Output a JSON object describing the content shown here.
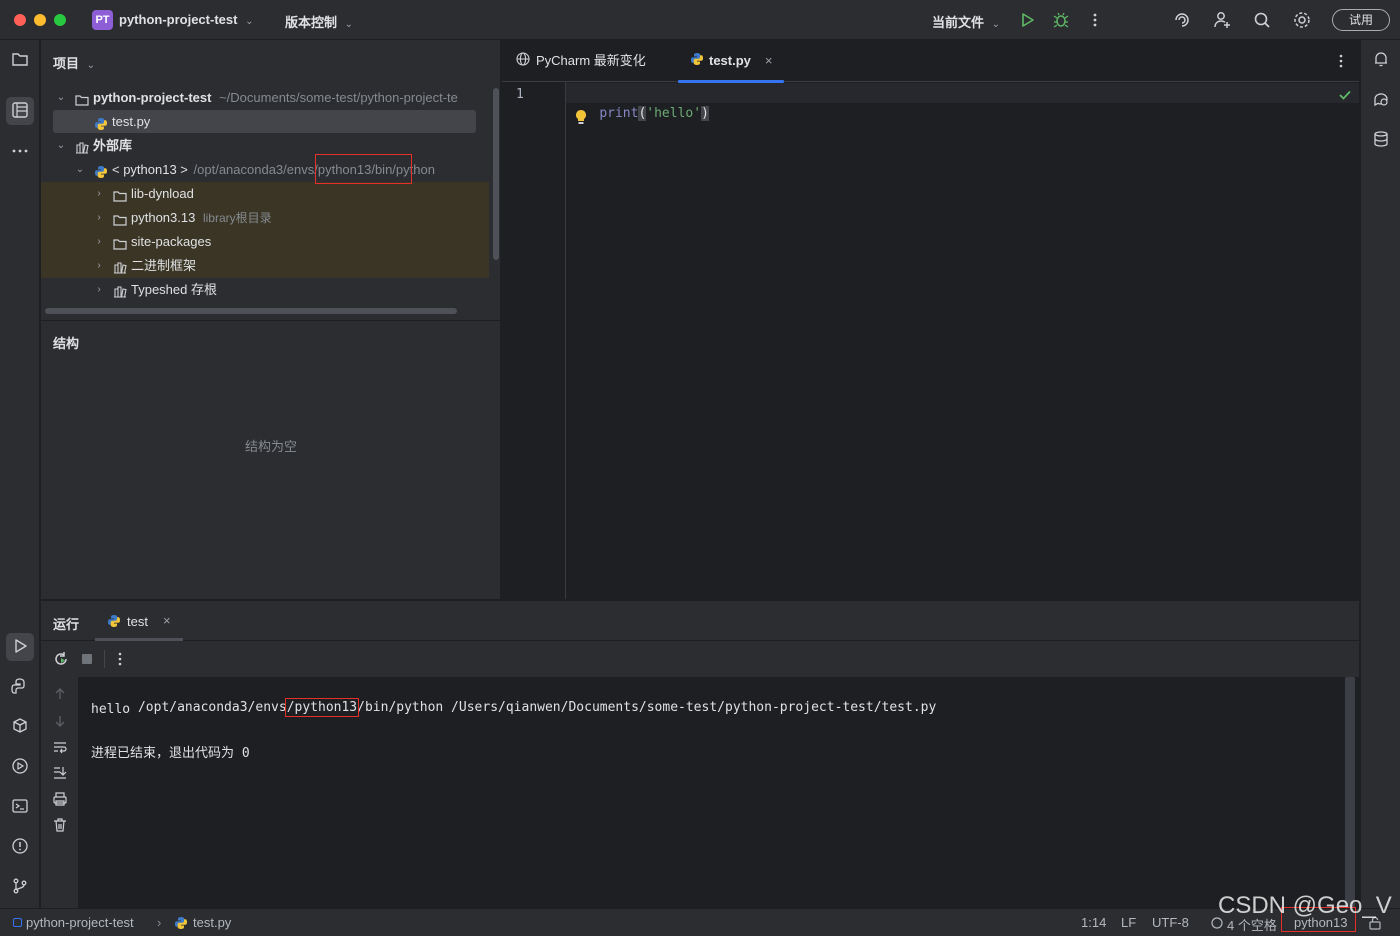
{
  "titlebar": {
    "project_badge": "PT",
    "project_name": "python-project-test",
    "vcs_menu": "版本控制",
    "run_config": "当前文件",
    "trial_button": "试用",
    "icons": [
      "run-icon",
      "debug-icon",
      "more-icon",
      "ai-assistant-icon",
      "add-user-icon",
      "search-icon",
      "settings-icon"
    ]
  },
  "project_panel": {
    "title": "项目",
    "tree": [
      {
        "label": "python-project-test",
        "hint": "~/Documents/some-test/python-project-te"
      },
      {
        "label": "test.py"
      },
      {
        "label": "外部库"
      },
      {
        "label": "< python13 >",
        "hint": "/opt/anaconda3/envs/python13/bin/python"
      },
      {
        "label": "lib-dynload"
      },
      {
        "label": "python3.13",
        "hint": "library根目录"
      },
      {
        "label": "site-packages"
      },
      {
        "label": "二进制框架"
      },
      {
        "label": "Typeshed 存根"
      }
    ]
  },
  "structure_panel": {
    "title": "结构",
    "empty_text": "结构为空"
  },
  "editor": {
    "tabs": [
      {
        "label": "PyCharm 最新变化"
      },
      {
        "label": "test.py",
        "active": true
      }
    ],
    "line_number": "1",
    "code": {
      "func": "print",
      "open": "(",
      "string": "'hello'",
      "close": ")"
    }
  },
  "run_panel": {
    "title": "运行",
    "tab_label": "test",
    "console": {
      "cmd_prefix": "/opt/anaconda3/envs",
      "cmd_highlight": "/python13",
      "cmd_suffix": "/bin/python /Users/qianwen/Documents/some-test/python-project-test/test.py",
      "output": "hello",
      "exit_message": "进程已结束，退出代码为 0"
    }
  },
  "statusbar": {
    "breadcrumb_project": "python-project-test",
    "breadcrumb_file": "test.py",
    "position": "1:14",
    "line_separator": "LF",
    "encoding": "UTF-8",
    "indent": "4 个空格",
    "interpreter": "python13"
  },
  "watermark": "CSDN @Geo_V",
  "colors": {
    "accent": "#3574f0",
    "highlight_box": "#e5302a",
    "run_green": "#5fb865",
    "library_bg": "#3a3524"
  }
}
